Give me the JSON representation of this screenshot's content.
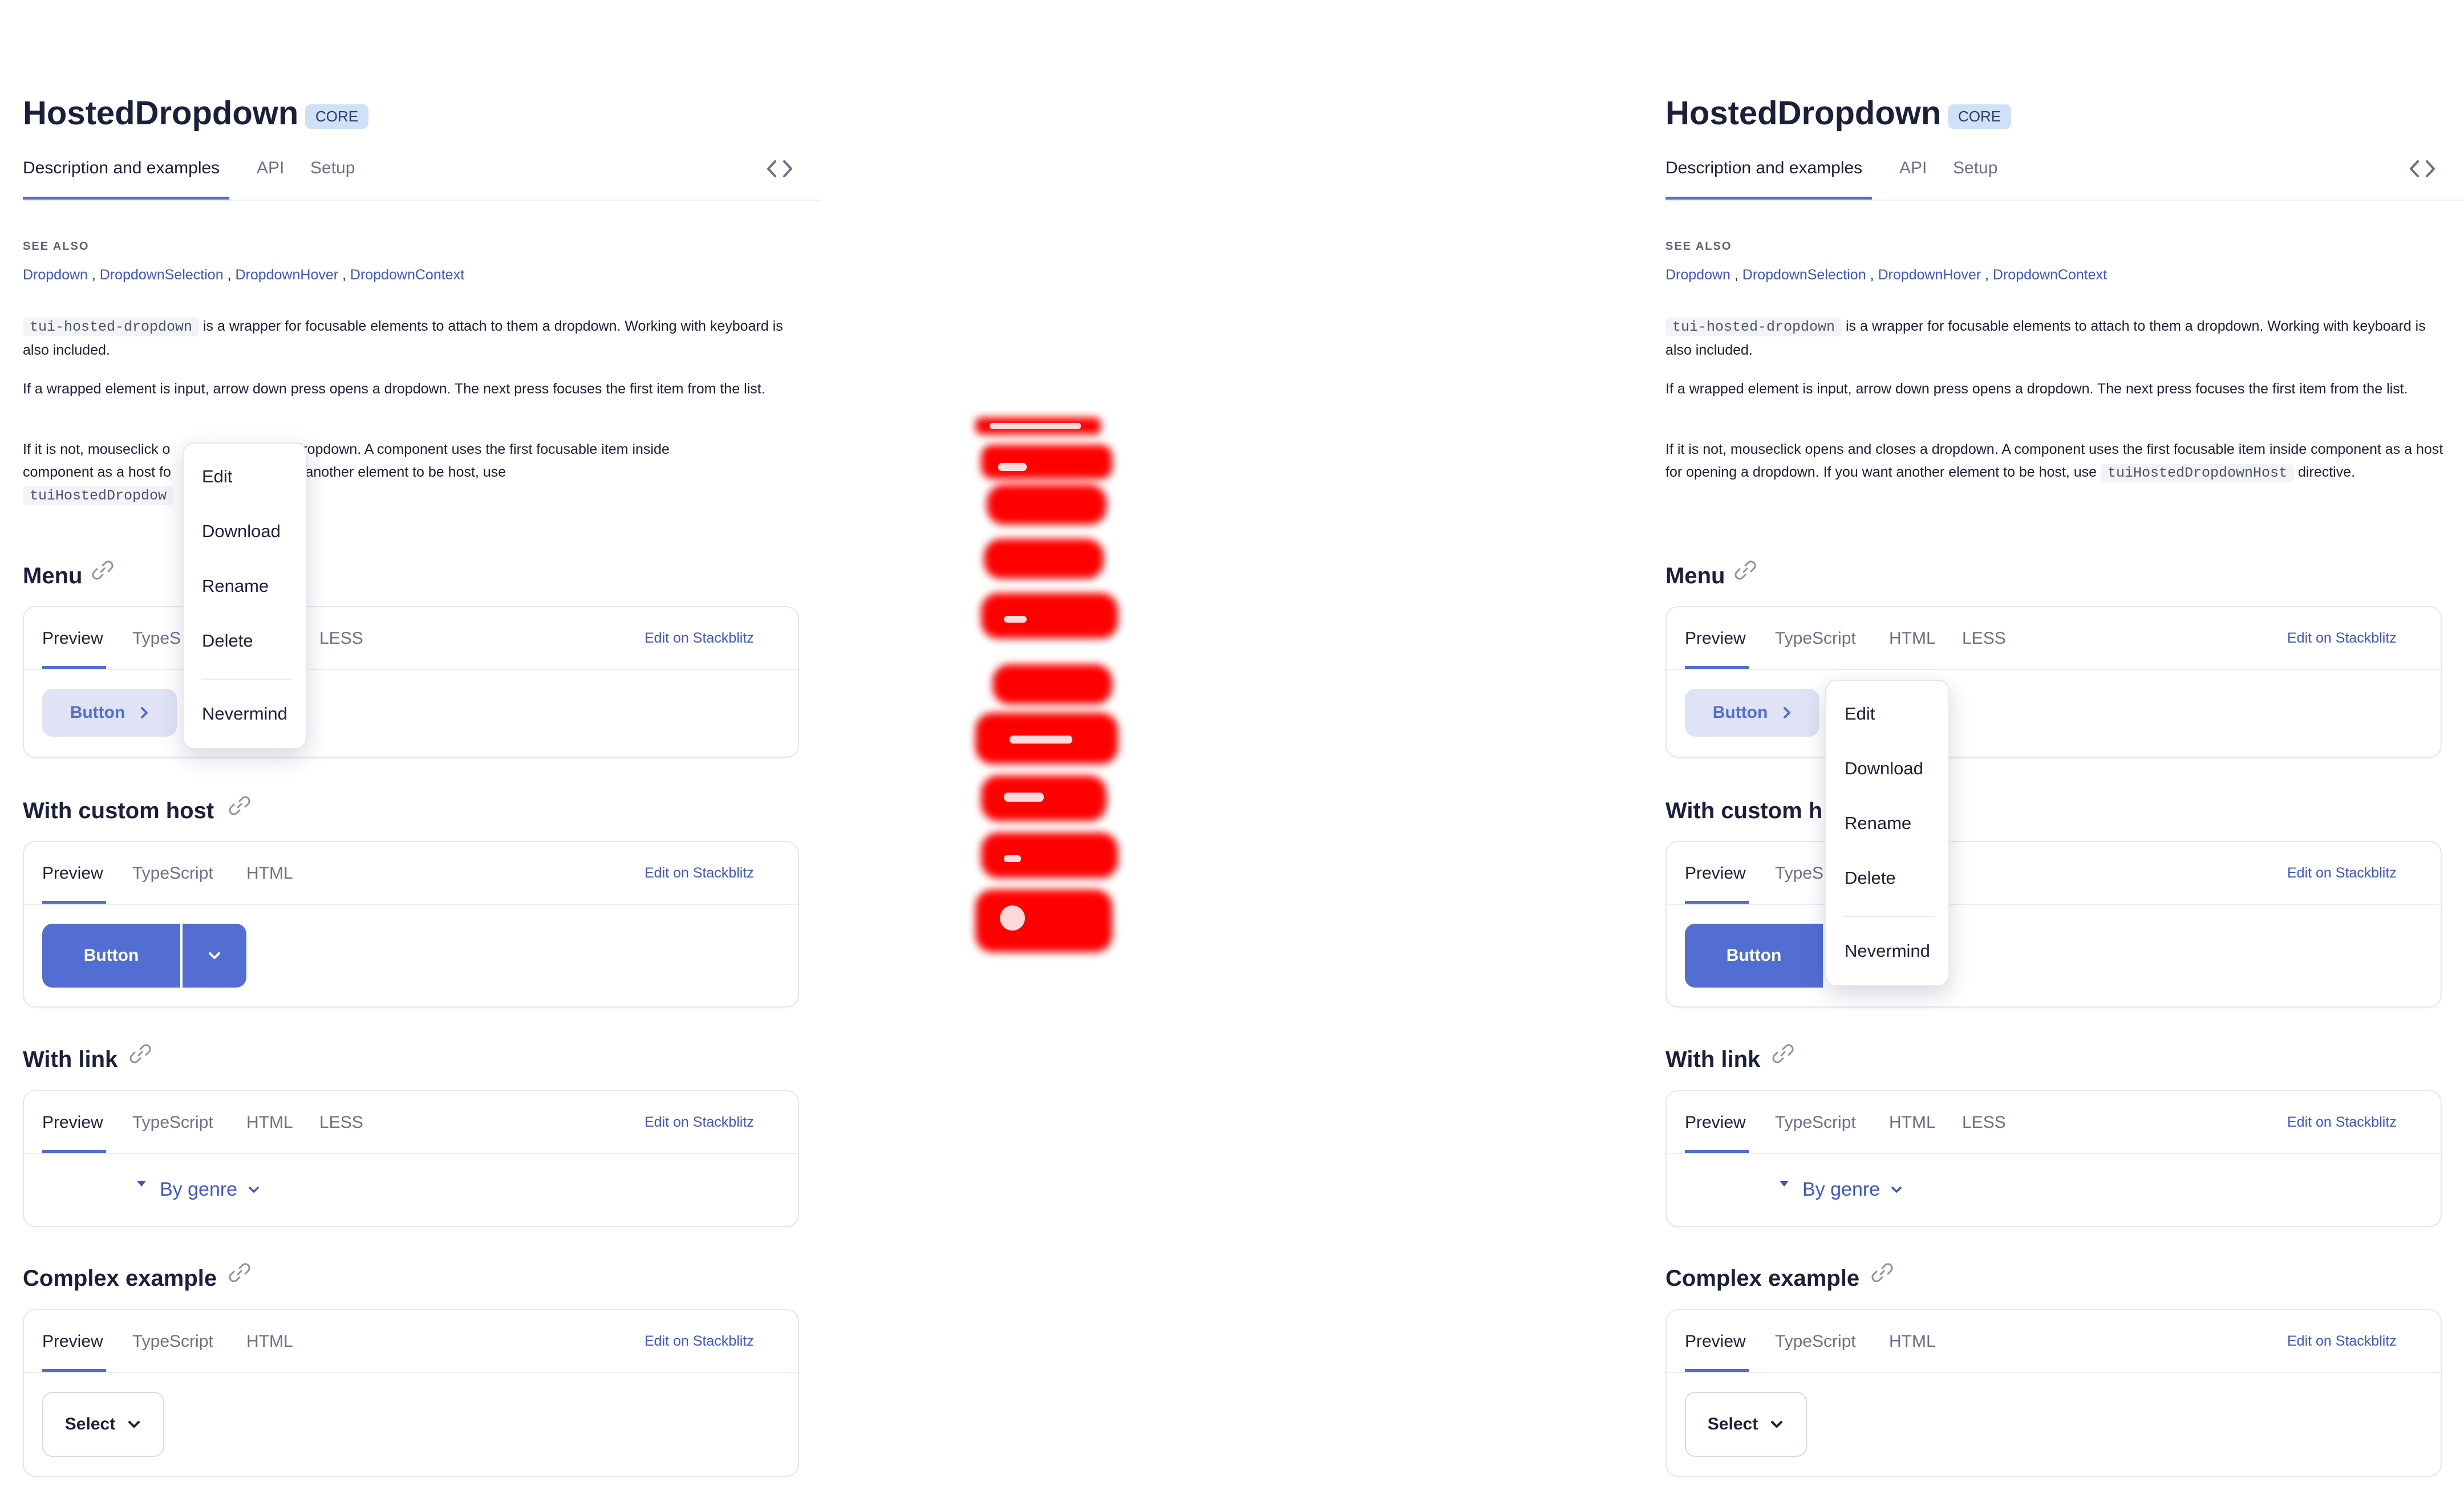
{
  "page": {
    "title": "HostedDropdown",
    "badge": "CORE",
    "tabs": [
      "Description and examples",
      "API",
      "Setup"
    ],
    "see_also_label": "SEE ALSO",
    "see_also_links": [
      "Dropdown",
      "DropdownSelection",
      "DropdownHover",
      "DropdownContext"
    ],
    "see_also_sep": ",",
    "para1_code": "tui-hosted-dropdown",
    "para1_text": "is a wrapper for focusable elements to attach to them a dropdown. Working with keyboard is also included.",
    "para2": "If a wrapped element is input, arrow down press opens a dropdown. The next press focuses the first item from the list.",
    "para3_text": "If it is not, mouseclick opens and closes a dropdown. A component uses the first focusable item inside component as a host for opening a dropdown. If you want another element to be host, use",
    "para3_code": "tuiHostedDropdownHost",
    "para3_tail": "directive.",
    "para3_left_line1_a": "If it is not, mouseclick o",
    "para3_left_line1_b": "dropdown. A component uses the first focusable item inside",
    "para3_left_line2_a": "component as a host fo",
    "para3_left_line2_b": "own. If you want another element to be host, use",
    "para3_left_code": "tuiHostedDropdow",
    "para3_left_tail": ".",
    "edit_on_stackblitz": "Edit on Stackblitz",
    "sections": [
      {
        "title": "Menu",
        "tabs": [
          "Preview",
          "TypeScript",
          "HTML",
          "LESS"
        ],
        "button": "Button"
      },
      {
        "title": "With custom host",
        "tabs": [
          "Preview",
          "TypeScript",
          "HTML"
        ],
        "button": "Button"
      },
      {
        "title": "With link",
        "tabs": [
          "Preview",
          "TypeScript",
          "HTML",
          "LESS"
        ],
        "link": "By genre"
      },
      {
        "title": "Complex example",
        "tabs": [
          "Preview",
          "TypeScript",
          "HTML"
        ],
        "button": "Select"
      }
    ],
    "left_visible": {
      "menu_tab2": "TypeS",
      "menu_tab4": "LESS"
    },
    "right_visible": {
      "custom_title": "With custom h",
      "custom_tab2": "TypeS"
    },
    "dropdown": {
      "items": [
        "Edit",
        "Download",
        "Rename",
        "Delete"
      ],
      "footer": "Nevermind"
    }
  },
  "colors": {
    "accent": "#526ed3",
    "link": "#3d57c4",
    "badge_bg": "#cfe0f7",
    "diff_highlight": "#ff0000"
  }
}
